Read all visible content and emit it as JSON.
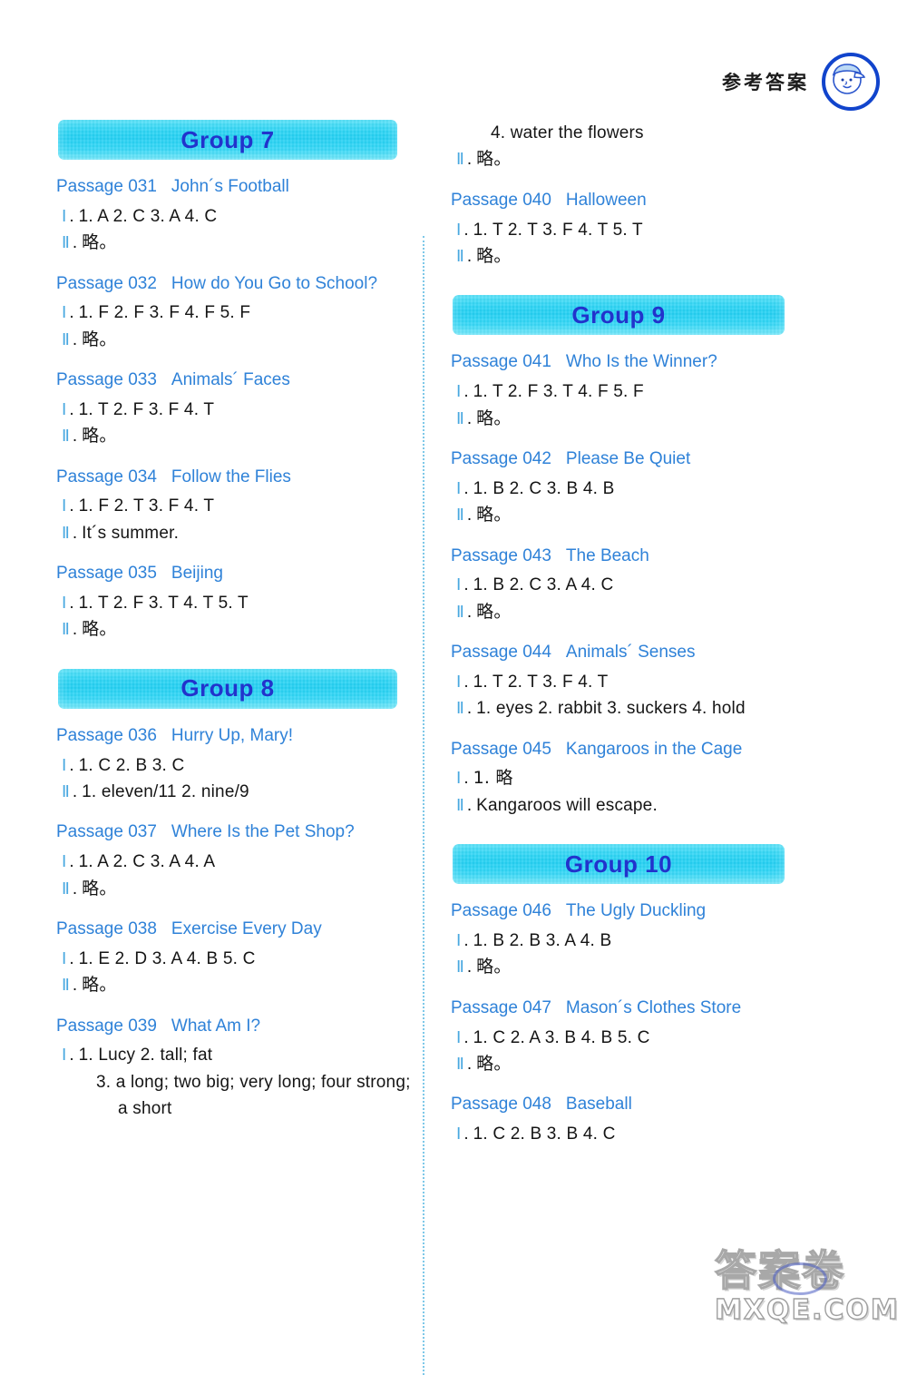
{
  "header": {
    "title": "参考答案",
    "avatar_icon": "boy-with-cap-avatar-icon"
  },
  "watermark": {
    "cjk": "答案卷",
    "domain": "MXQE.COM"
  },
  "colors": {
    "banner_cyan": "#22cff2",
    "banner_text": "#2233cc",
    "passage_title": "#2f82d8",
    "numeral": "#49a8e0",
    "answer_text": "#151515",
    "divider": "#7ec8e8"
  },
  "columns": {
    "left": [
      {
        "kind": "banner",
        "label": "Group 7"
      },
      {
        "kind": "passage",
        "number": "Passage 031",
        "title": "John´s Football",
        "lines": [
          {
            "numeral": "Ⅰ",
            "dot": ".",
            "text": "1. A   2. C   3. A   4. C"
          },
          {
            "numeral": "Ⅱ",
            "dot": ".",
            "text": "略。",
            "cjk": true
          }
        ]
      },
      {
        "kind": "passage",
        "number": "Passage 032",
        "title": "How do You Go to School?",
        "lines": [
          {
            "numeral": "Ⅰ",
            "dot": ".",
            "text": "1. F   2. F   3. F   4. F   5. F"
          },
          {
            "numeral": "Ⅱ",
            "dot": ".",
            "text": "略。",
            "cjk": true
          }
        ]
      },
      {
        "kind": "passage",
        "number": "Passage 033",
        "title": "Animals´ Faces",
        "lines": [
          {
            "numeral": "Ⅰ",
            "dot": ".",
            "text": "1. T   2. F   3. F   4. T"
          },
          {
            "numeral": "Ⅱ",
            "dot": ".",
            "text": "略。",
            "cjk": true
          }
        ]
      },
      {
        "kind": "passage",
        "number": "Passage 034",
        "title": "Follow the Flies",
        "lines": [
          {
            "numeral": "Ⅰ",
            "dot": ".",
            "text": "1. F   2. T   3. F   4. T"
          },
          {
            "numeral": "Ⅱ",
            "dot": ".",
            "text": "It´s summer."
          }
        ]
      },
      {
        "kind": "passage",
        "number": "Passage 035",
        "title": "Beijing",
        "lines": [
          {
            "numeral": "Ⅰ",
            "dot": ".",
            "text": "1. T   2. F   3. T   4. T   5. T"
          },
          {
            "numeral": "Ⅱ",
            "dot": ".",
            "text": "略。",
            "cjk": true
          }
        ]
      },
      {
        "kind": "banner",
        "label": "Group 8"
      },
      {
        "kind": "passage",
        "number": "Passage 036",
        "title": "Hurry Up, Mary!",
        "lines": [
          {
            "numeral": "Ⅰ",
            "dot": ".",
            "text": "1. C   2. B   3. C"
          },
          {
            "numeral": "Ⅱ",
            "dot": ".",
            "text": "1. eleven/11   2. nine/9"
          }
        ]
      },
      {
        "kind": "passage",
        "number": "Passage 037",
        "title": "Where Is the Pet Shop?",
        "lines": [
          {
            "numeral": "Ⅰ",
            "dot": ".",
            "text": "1. A   2. C   3. A   4. A"
          },
          {
            "numeral": "Ⅱ",
            "dot": ".",
            "text": "略。",
            "cjk": true
          }
        ]
      },
      {
        "kind": "passage",
        "number": "Passage 038",
        "title": "Exercise Every Day",
        "lines": [
          {
            "numeral": "Ⅰ",
            "dot": ".",
            "text": "1. E   2. D   3. A   4. B   5. C"
          },
          {
            "numeral": "Ⅱ",
            "dot": ".",
            "text": "略。",
            "cjk": true
          }
        ]
      },
      {
        "kind": "passage",
        "number": "Passage 039",
        "title": "What Am I?",
        "lines": [
          {
            "numeral": "Ⅰ",
            "dot": ".",
            "text": "1. Lucy   2. tall; fat"
          },
          {
            "numeral": "",
            "dot": "",
            "text": "3. a long; two big; very long; four strong;",
            "indent": "cont"
          },
          {
            "numeral": "",
            "dot": "",
            "text": "a short",
            "indent": "cont2"
          }
        ]
      }
    ],
    "right": [
      {
        "kind": "orphan",
        "lines": [
          {
            "numeral": "",
            "dot": "",
            "text": "4. water the flowers",
            "indent": "cont"
          },
          {
            "numeral": "Ⅱ",
            "dot": ".",
            "text": "略。",
            "cjk": true
          }
        ]
      },
      {
        "kind": "passage",
        "number": "Passage 040",
        "title": "Halloween",
        "lines": [
          {
            "numeral": "Ⅰ",
            "dot": ".",
            "text": "1. T   2. T   3. F   4. T   5. T"
          },
          {
            "numeral": "Ⅱ",
            "dot": ".",
            "text": "略。",
            "cjk": true
          }
        ]
      },
      {
        "kind": "banner",
        "label": "Group 9"
      },
      {
        "kind": "passage",
        "number": "Passage 041",
        "title": "Who Is the Winner?",
        "lines": [
          {
            "numeral": "Ⅰ",
            "dot": ".",
            "text": "1. T   2. F   3. T   4. F   5. F"
          },
          {
            "numeral": "Ⅱ",
            "dot": ".",
            "text": "略。",
            "cjk": true
          }
        ]
      },
      {
        "kind": "passage",
        "number": "Passage 042",
        "title": "Please Be Quiet",
        "lines": [
          {
            "numeral": "Ⅰ",
            "dot": ".",
            "text": "1. B   2. C   3. B   4. B"
          },
          {
            "numeral": "Ⅱ",
            "dot": ".",
            "text": "略。",
            "cjk": true
          }
        ]
      },
      {
        "kind": "passage",
        "number": "Passage 043",
        "title": "The Beach",
        "lines": [
          {
            "numeral": "Ⅰ",
            "dot": ".",
            "text": "1. B   2. C   3. A   4. C"
          },
          {
            "numeral": "Ⅱ",
            "dot": ".",
            "text": "略。",
            "cjk": true
          }
        ]
      },
      {
        "kind": "passage",
        "number": "Passage 044",
        "title": "Animals´ Senses",
        "lines": [
          {
            "numeral": "Ⅰ",
            "dot": ".",
            "text": "1. T   2. T   3. F   4. T"
          },
          {
            "numeral": "Ⅱ",
            "dot": ".",
            "text": "1. eyes   2. rabbit   3. suckers   4. hold"
          }
        ]
      },
      {
        "kind": "passage",
        "number": "Passage 045",
        "title": "Kangaroos in the Cage",
        "lines": [
          {
            "numeral": "Ⅰ",
            "dot": ".",
            "text": "1. 略",
            "cjk": true
          },
          {
            "numeral": "Ⅱ",
            "dot": ".",
            "text": "Kangaroos will escape."
          }
        ]
      },
      {
        "kind": "banner",
        "label": "Group 10"
      },
      {
        "kind": "passage",
        "number": "Passage 046",
        "title": "The Ugly Duckling",
        "lines": [
          {
            "numeral": "Ⅰ",
            "dot": ".",
            "text": "1. B   2. B   3. A   4. B"
          },
          {
            "numeral": "Ⅱ",
            "dot": ".",
            "text": "略。",
            "cjk": true
          }
        ]
      },
      {
        "kind": "passage",
        "number": "Passage 047",
        "title": "Mason´s Clothes Store",
        "lines": [
          {
            "numeral": "Ⅰ",
            "dot": ".",
            "text": "1. C   2. A   3. B   4. B   5. C"
          },
          {
            "numeral": "Ⅱ",
            "dot": ".",
            "text": "略。",
            "cjk": true
          }
        ]
      },
      {
        "kind": "passage",
        "number": "Passage 048",
        "title": "Baseball",
        "lines": [
          {
            "numeral": "Ⅰ",
            "dot": ".",
            "text": "1. C   2. B   3. B   4. C"
          }
        ]
      }
    ]
  }
}
